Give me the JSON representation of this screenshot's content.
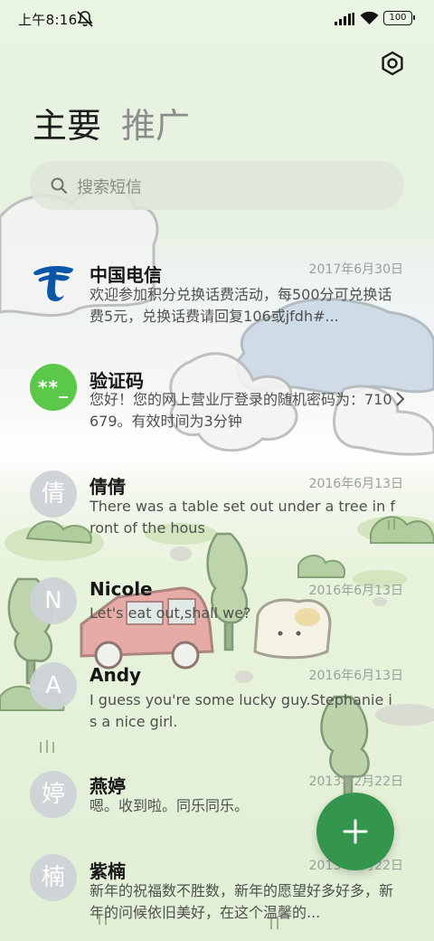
{
  "status_bar": {
    "time": "上午8:16",
    "battery": "100",
    "icons": [
      "mute-icon",
      "signal-icon",
      "wifi-icon",
      "battery-icon"
    ]
  },
  "header": {
    "settings_icon": "gear-icon"
  },
  "tabs": [
    {
      "label": "主要",
      "active": true
    },
    {
      "label": "推广",
      "active": false
    }
  ],
  "search": {
    "placeholder": "搜索短信",
    "icon": "search-icon"
  },
  "messages": [
    {
      "name": "中国电信",
      "date": "2017年6月30日",
      "preview": "欢迎参加积分兑换话费活动，每500分可兑换话费5元，兑换话费请回复106或jfdh#...",
      "avatar": {
        "type": "logo",
        "icon": "china-telecom-logo"
      }
    },
    {
      "name": "验证码",
      "date": "",
      "preview": "您好！您的网上营业厅登录的随机密码为：710679。有效时间为3分钟",
      "avatar": {
        "type": "icon",
        "text": "**_"
      },
      "chevron": "chevron-right-icon"
    },
    {
      "name": "倩倩",
      "date": "2016年6月13日",
      "preview": "There was a table set out under a tree in front of the hous",
      "avatar": {
        "type": "initial",
        "text": "倩"
      }
    },
    {
      "name": "Nicole",
      "date": "2016年6月13日",
      "preview": "Let's eat out,shall we?",
      "avatar": {
        "type": "initial",
        "text": "N"
      }
    },
    {
      "name": "Andy",
      "date": "2016年6月13日",
      "preview": "I guess you're some lucky guy.Stephanie is a nice girl.",
      "avatar": {
        "type": "initial",
        "text": "A"
      }
    },
    {
      "name": "燕婷",
      "date": "2013年2月22日",
      "preview": "嗯。收到啦。同乐同乐。",
      "avatar": {
        "type": "initial",
        "text": "婷"
      }
    },
    {
      "name": "紫楠",
      "date": "2013年2月22日",
      "preview": "新年的祝福数不胜数，新年的愿望好多好多，新年的问候依旧美好，在这个温馨的...",
      "avatar": {
        "type": "initial",
        "text": "楠"
      }
    }
  ],
  "fab": {
    "icon": "plus-icon"
  },
  "colors": {
    "accent": "#34954d",
    "verification_avatar": "#5cc84a",
    "telecom_blue": "#0a56a8"
  }
}
